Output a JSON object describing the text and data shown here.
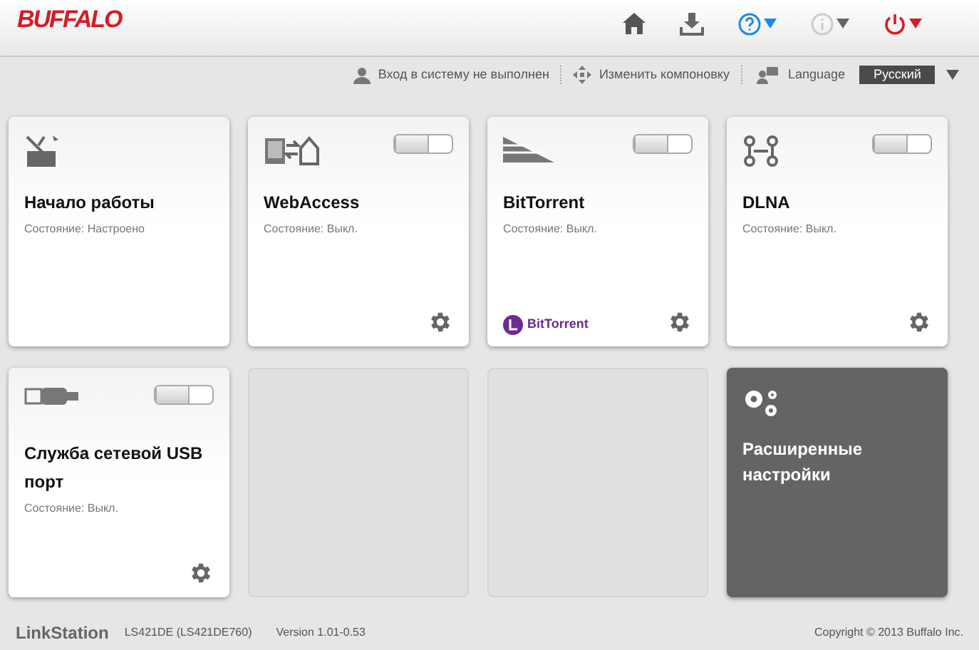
{
  "header": {
    "logo": "BUFFALO"
  },
  "toolbar": {
    "login": "Вход в систему не выполнен",
    "layout": "Изменить компоновку",
    "language_label": "Language",
    "language": "Русский"
  },
  "tiles": [
    {
      "kind": "app",
      "title": "Начало работы",
      "status": "Состояние: Настроено"
    },
    {
      "kind": "app",
      "title": "WebAccess",
      "status": "Состояние: Выкл.",
      "toggle": {
        "on": false
      },
      "gear": true
    },
    {
      "kind": "app",
      "title": "BitTorrent",
      "status": "Состояние: Выкл.",
      "toggle": {
        "on": false
      },
      "gear": true,
      "brand": "BitTorrent"
    },
    {
      "kind": "app",
      "title": "DLNA",
      "status": "Состояние: Выкл.",
      "toggle": {
        "on": false
      },
      "gear": true
    },
    {
      "kind": "app",
      "title": "Служба сетевой USB порт",
      "status": "Состояние: Выкл.",
      "toggle": {
        "on": false
      },
      "gear": true
    },
    {
      "kind": "empty"
    },
    {
      "kind": "empty"
    },
    {
      "kind": "advanced",
      "title": "Расширенные настройки"
    }
  ],
  "footer": {
    "product": "LinkStation",
    "model": "LS421DE (LS421DE760)",
    "version": "Version 1.01-0.53",
    "copyright": "Copyright © 2013 Buffalo Inc."
  }
}
